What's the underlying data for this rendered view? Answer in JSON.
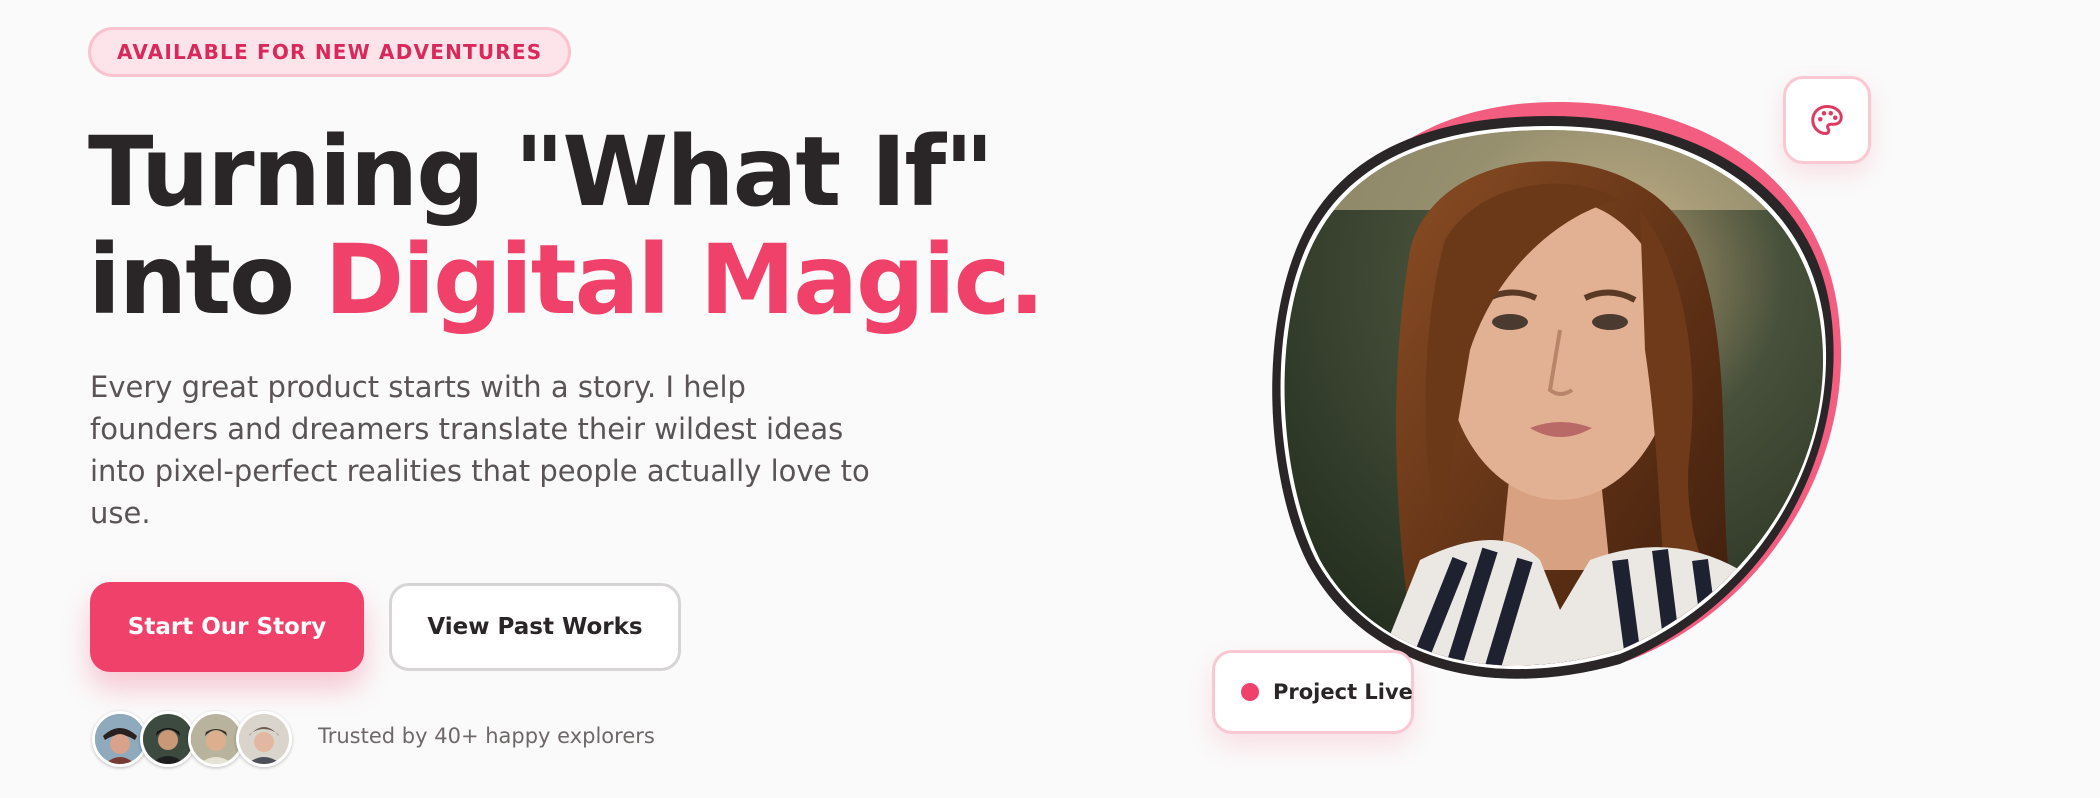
{
  "hero": {
    "badge": "AVAILABLE FOR NEW ADVENTURES",
    "headline_line1": "Turning \"What If\"",
    "headline_line2_prefix": "into ",
    "headline_accent": "Digital Magic.",
    "lead": "Every great product starts with a story. I help founders and dreamers translate their wildest ideas into pixel-perfect realities that people actually love to use.",
    "primary_button": "Start Our Story",
    "secondary_button": "View Past Works",
    "trust_text": "Trusted by 40+ happy explorers"
  },
  "visual": {
    "floating_icon": "palette-icon",
    "status_label": "Project Live"
  },
  "colors": {
    "accent": "#f0416a",
    "ink": "#2a2526",
    "background": "#fafafa",
    "badge_background": "#fde4ea"
  }
}
